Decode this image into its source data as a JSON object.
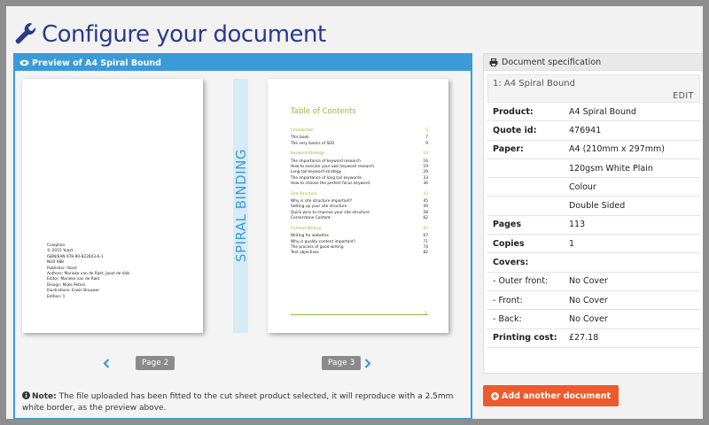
{
  "header": {
    "title": "Configure your document",
    "icon": "wrench-icon"
  },
  "preview": {
    "title": "Preview of A4 Spiral Bound",
    "binding_text": "SPIRAL BINDING",
    "left_page_label": "Page 2",
    "right_page_label": "Page 3",
    "colophon": [
      "Colophon",
      "© 2015 Yoast",
      "ISBN/EAN 978-90-822603-6-1",
      "NUR 988",
      "Publisher: Yoast",
      "Authors: Marieke van de Rakt, Joost de Valk",
      "Editor: Marieke van de Rakt",
      "Design: Mijke Peters",
      "Illustrations: Erwin Brouwer",
      "Edition: 1"
    ],
    "toc": {
      "title": "Table of Contents",
      "sections": [
        {
          "name": "Introduction",
          "page": "5",
          "items": [
            {
              "t": "This book",
              "p": "7"
            },
            {
              "t": "The very basics of SEO",
              "p": "9"
            }
          ]
        },
        {
          "name": "Keyword Strategy",
          "page": "14",
          "items": [
            {
              "t": "The importance of keyword research",
              "p": "16"
            },
            {
              "t": "How to execute your own keyword research",
              "p": "19"
            },
            {
              "t": "Long tail keyword strategy",
              "p": "29"
            },
            {
              "t": "The importance of long tail keywords",
              "p": "33"
            },
            {
              "t": "How to choose the perfect focus keyword",
              "p": "36"
            }
          ]
        },
        {
          "name": "Site Structure",
          "page": "43",
          "items": [
            {
              "t": "Why is site structure important?",
              "p": "45"
            },
            {
              "t": "Setting up your site structure",
              "p": "49"
            },
            {
              "t": "Quick wins to improve your site structure",
              "p": "58"
            },
            {
              "t": "Cornerstone Content",
              "p": "62"
            }
          ]
        },
        {
          "name": "Content Writing",
          "page": "65",
          "items": [
            {
              "t": "Writing for websites",
              "p": "67"
            },
            {
              "t": "Why is quality content important?",
              "p": "71"
            },
            {
              "t": "The process of good writing",
              "p": "74"
            },
            {
              "t": "Text objectives",
              "p": "82"
            }
          ]
        }
      ],
      "footer_page": "3"
    },
    "note_label": "Note:",
    "note_text": " The file uploaded has been fitted to the cut sheet product selected, it will reproduce with a 2.5mm white border, as the preview above."
  },
  "spec": {
    "title": "Document specification",
    "item_title": "1: A4 Spiral Bound",
    "edit_label": "EDIT",
    "rows": [
      {
        "key": "Product:",
        "value": "A4 Spiral Bound"
      },
      {
        "key": "Quote id:",
        "value": "476941"
      },
      {
        "key": "Paper:",
        "value": "A4 (210mm x 297mm)"
      },
      {
        "key": "",
        "value": "120gsm White Plain"
      },
      {
        "key": "",
        "value": "Colour"
      },
      {
        "key": "",
        "value": "Double Sided"
      },
      {
        "key": "Pages",
        "value": "113"
      },
      {
        "key": "Copies",
        "value": "1"
      },
      {
        "key": "Covers:",
        "value": ""
      },
      {
        "key": "- Outer front:",
        "value": "No Cover",
        "plain": true
      },
      {
        "key": "- Front:",
        "value": "No Cover",
        "plain": true
      },
      {
        "key": "- Back:",
        "value": "No Cover",
        "plain": true
      },
      {
        "key": "Printing cost:",
        "value": "£27.18"
      }
    ]
  },
  "add_button_label": "Add another document",
  "colors": {
    "brand": "#2b3a8c",
    "accent": "#3a9bd8",
    "green": "#8dbd3a",
    "cta": "#ee5a2c"
  }
}
